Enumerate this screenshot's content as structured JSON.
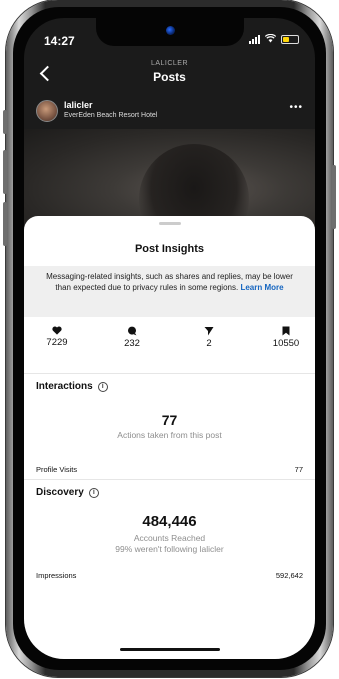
{
  "status_bar": {
    "time": "14:27"
  },
  "nav": {
    "subtitle": "LALICLER",
    "title": "Posts"
  },
  "post": {
    "username": "lalicler",
    "location": "EverEden Beach Resort Hotel",
    "more": "•••"
  },
  "sheet": {
    "title": "Post Insights",
    "notice_text": "Messaging-related insights, such as shares and replies, may be lower than expected due to privacy rules in some regions.",
    "notice_link": "Learn More"
  },
  "stats": [
    {
      "icon": "heart-icon",
      "value": "7229"
    },
    {
      "icon": "comment-icon",
      "value": "232"
    },
    {
      "icon": "share-icon",
      "value": "2"
    },
    {
      "icon": "bookmark-icon",
      "value": "10550"
    }
  ],
  "interactions": {
    "title": "Interactions",
    "total": "77",
    "caption": "Actions taken from this post",
    "profile_visits_label": "Profile Visits",
    "profile_visits_value": "77"
  },
  "discovery": {
    "title": "Discovery",
    "accounts_reached": "484,446",
    "caption1": "Accounts Reached",
    "caption2": "99% weren't following lalicler",
    "impressions_label": "Impressions",
    "impressions_value": "592,642"
  },
  "colors": {
    "link": "#1565c0",
    "battery": "#ffd60a",
    "sheet_bg": "#ffffff",
    "notice_bg": "#efefef"
  }
}
